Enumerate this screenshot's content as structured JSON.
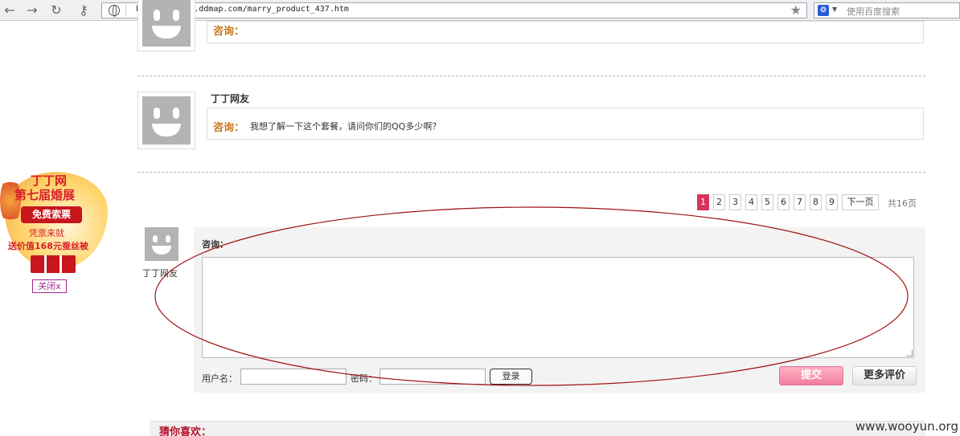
{
  "browser": {
    "url": "http://marry.ddmap.com/marry_product_437.htm",
    "search_placeholder": "使用百度搜索"
  },
  "comments": [
    {
      "label": "咨询：",
      "text": ""
    },
    {
      "username": "丁丁网友",
      "label": "咨询：",
      "text": "我想了解一下这个套餐，请问你们的QQ多少啊？"
    }
  ],
  "pagination": {
    "pages": [
      "1",
      "2",
      "3",
      "4",
      "5",
      "6",
      "7",
      "8",
      "9"
    ],
    "next_label": "下一页",
    "total": "共16页"
  },
  "form": {
    "poster_name": "丁丁网友",
    "label": "咨询：",
    "username_label": "用户名：",
    "password_label": "密码：",
    "login_button": "登录",
    "submit_button": "提交",
    "more_reviews_button": "更多评价"
  },
  "recommend": {
    "title": "猜你喜欢："
  },
  "ad": {
    "line1": "丁丁网",
    "line2": "第七届婚展",
    "button": "免费索票",
    "line3": "凭票来就",
    "line4": "送价值168元蚕丝被",
    "close": "关闭x"
  },
  "watermark": "www.wooyun.org",
  "colors": {
    "accent": "#d8365a",
    "label": "#c8781e",
    "annotation": "#a01010"
  }
}
